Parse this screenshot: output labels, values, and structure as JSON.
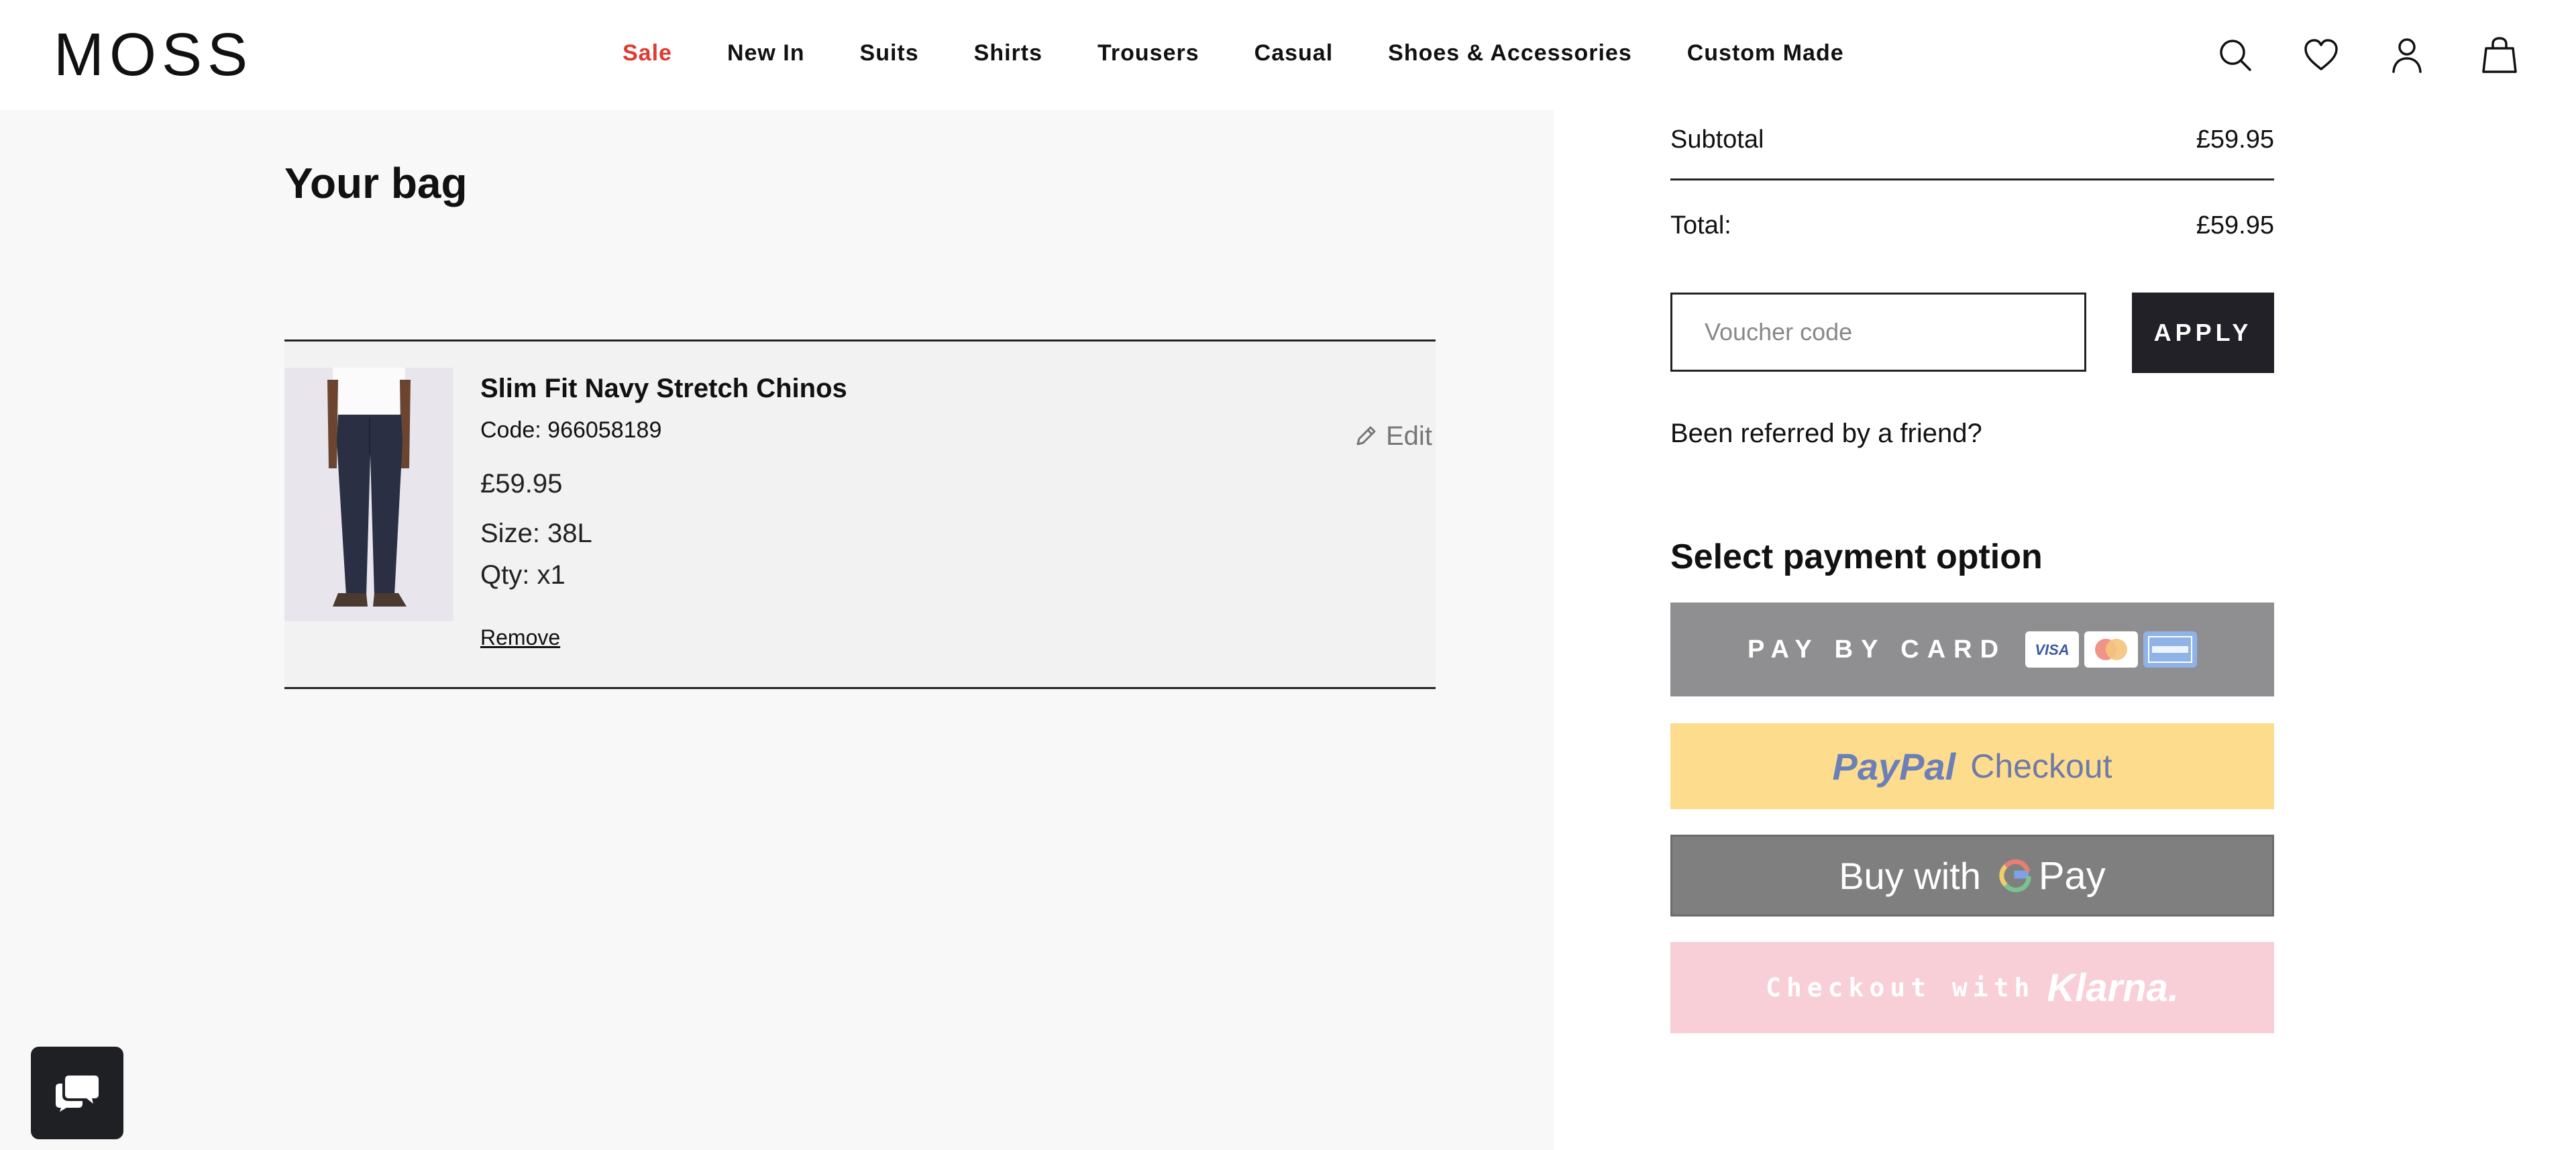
{
  "brand": {
    "logo_text": "MOSS"
  },
  "nav": {
    "items": [
      {
        "label": "Sale"
      },
      {
        "label": "New In"
      },
      {
        "label": "Suits"
      },
      {
        "label": "Shirts"
      },
      {
        "label": "Trousers"
      },
      {
        "label": "Casual"
      },
      {
        "label": "Shoes & Accessories"
      },
      {
        "label": "Custom Made"
      }
    ]
  },
  "header_icons": [
    "search-icon",
    "heart-icon",
    "account-icon",
    "bag-icon"
  ],
  "bag": {
    "title": "Your bag",
    "items": [
      {
        "name": "Slim Fit Navy Stretch Chinos",
        "code": "Code: 966058189",
        "price": "£59.95",
        "size": "Size: 38L",
        "qty": "Qty: x1",
        "remove_label": "Remove",
        "edit_label": "Edit"
      }
    ]
  },
  "summary": {
    "subtotal_label": "Subtotal",
    "subtotal_value": "£59.95",
    "total_label": "Total:",
    "total_value": "£59.95"
  },
  "voucher": {
    "placeholder": "Voucher code",
    "value": "",
    "apply_label": "APPLY"
  },
  "referral_text": "Been referred by a friend?",
  "payment": {
    "heading": "Select payment option",
    "card_label": "PAY BY CARD",
    "card_logos": [
      "visa-logo",
      "mastercard-logo",
      "amex-logo"
    ],
    "paypal_word": "PayPal",
    "paypal_checkout": "Checkout",
    "gpay_prefix": "Buy with",
    "gpay_word": "Pay",
    "klarna_prefix": "Checkout with",
    "klarna_word": "Klarna."
  },
  "colors": {
    "sale": "#e03a30",
    "apply_bg": "#222127",
    "card_bg": "#8f8f92",
    "paypal_bg": "#fddc8e",
    "gpay_bg": "#7f7f7f",
    "klarna_bg": "#f8cfd7"
  },
  "chat": {
    "icon": "chat-icon"
  }
}
